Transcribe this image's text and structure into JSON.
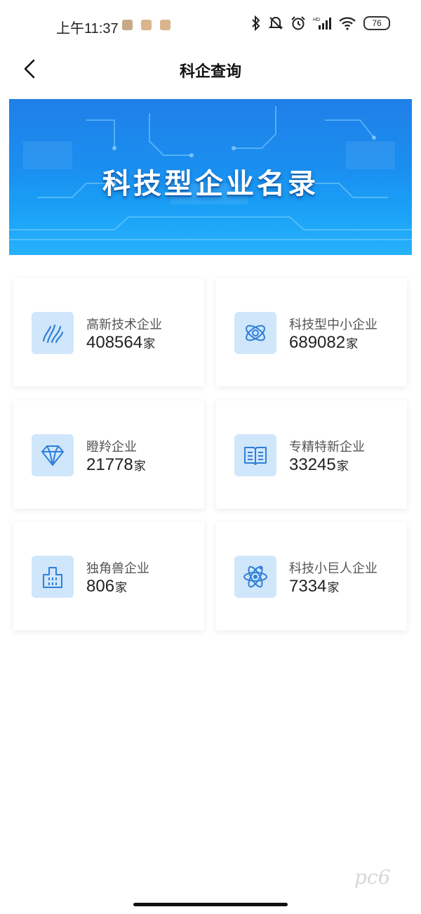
{
  "status_bar": {
    "time": "上午11:37",
    "battery": "76",
    "icons": [
      "bluetooth-icon",
      "muted-bell-icon",
      "alarm-icon",
      "hd-signal-icon",
      "wifi-icon",
      "battery-icon"
    ]
  },
  "nav": {
    "title": "科企查询",
    "back_icon": "chevron-left-icon"
  },
  "banner": {
    "title": "科技型企业名录"
  },
  "categories": [
    {
      "label": "高新技术企业",
      "count": "408564",
      "unit": "家",
      "icon": "flame-leaf-icon"
    },
    {
      "label": "科技型中小企业",
      "count": "689082",
      "unit": "家",
      "icon": "atom-ring-icon"
    },
    {
      "label": "瞪羚企业",
      "count": "21778",
      "unit": "家",
      "icon": "diamond-icon"
    },
    {
      "label": "专精特新企业",
      "count": "33245",
      "unit": "家",
      "icon": "open-book-icon"
    },
    {
      "label": "独角兽企业",
      "count": "806",
      "unit": "家",
      "icon": "building-icon"
    },
    {
      "label": "科技小巨人企业",
      "count": "7334",
      "unit": "家",
      "icon": "atom-icon"
    }
  ],
  "watermark": "pc6",
  "colors": {
    "accent": "#1a8ff0",
    "icon_bg": "#cfe6fb",
    "icon_stroke": "#2f7fd8"
  }
}
